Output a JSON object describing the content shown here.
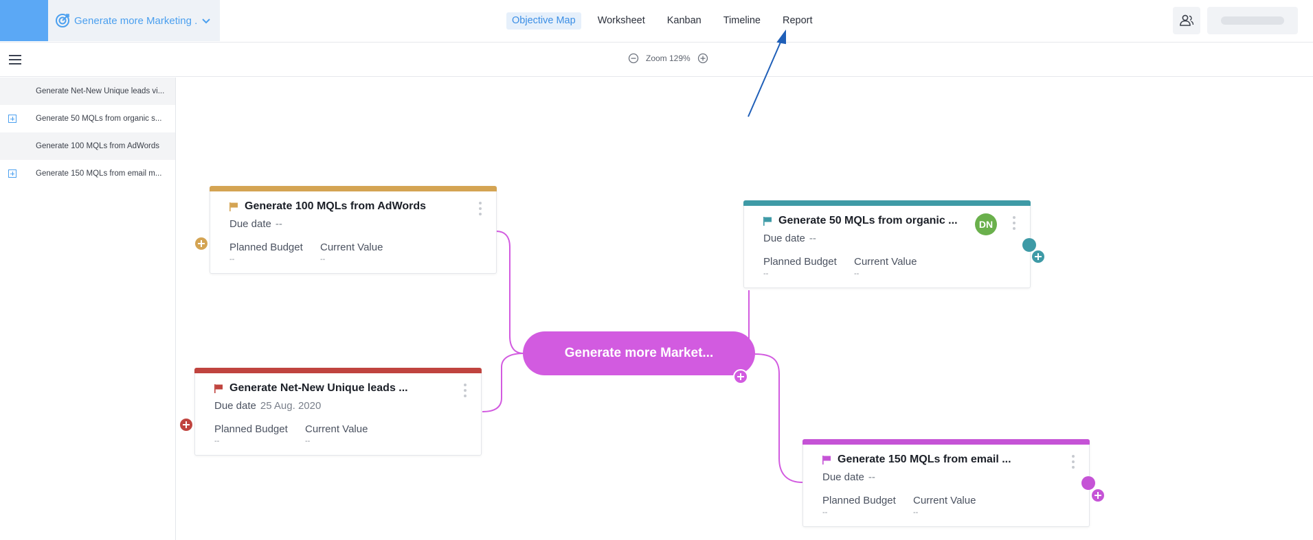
{
  "header": {
    "objective_selector": "Generate more Marketing ...",
    "tabs": [
      {
        "label": "Objective Map",
        "active": true
      },
      {
        "label": "Worksheet",
        "active": false
      },
      {
        "label": "Kanban",
        "active": false
      },
      {
        "label": "Timeline",
        "active": false
      },
      {
        "label": "Report",
        "active": false
      }
    ]
  },
  "toolbar": {
    "zoom_label": "Zoom 129%"
  },
  "sidebar": {
    "items": [
      {
        "label": "Generate Net-New Unique leads vi...",
        "expandable": false,
        "shaded": true
      },
      {
        "label": "Generate 50 MQLs from organic s...",
        "expandable": true,
        "shaded": false
      },
      {
        "label": "Generate 100 MQLs from AdWords",
        "expandable": false,
        "shaded": true
      },
      {
        "label": "Generate 150 MQLs from email m...",
        "expandable": true,
        "shaded": false
      }
    ]
  },
  "map": {
    "center_label": "Generate more Market...",
    "cards": [
      {
        "id": "adwords",
        "title": "Generate 100 MQLs from AdWords",
        "due_label": "Due date",
        "due_value": "--",
        "budget_label": "Planned Budget",
        "budget_value": "--",
        "current_label": "Current Value",
        "current_value": "--",
        "color": "#d4a453"
      },
      {
        "id": "organic",
        "title": "Generate 50 MQLs from organic    ...",
        "due_label": "Due date",
        "due_value": "--",
        "budget_label": "Planned Budget",
        "budget_value": "--",
        "current_label": "Current Value",
        "current_value": "--",
        "color": "#3e9aa6",
        "avatar": "DN",
        "avatar_color": "#6ab04c"
      },
      {
        "id": "netnew",
        "title": "Generate Net-New Unique leads    ...",
        "due_label": "Due date",
        "due_value": "25 Aug. 2020",
        "budget_label": "Planned Budget",
        "budget_value": "--",
        "current_label": "Current Value",
        "current_value": "--",
        "color": "#c0443f"
      },
      {
        "id": "email",
        "title": "Generate 150 MQLs from email    ...",
        "due_label": "Due date",
        "due_value": "--",
        "budget_label": "Planned Budget",
        "budget_value": "--",
        "current_label": "Current Value",
        "current_value": "--",
        "color": "#c553d6"
      }
    ]
  },
  "colors": {
    "accent": "#4a9fef",
    "center": "#d25be0",
    "arrow": "#1f5fb8"
  },
  "icons": [
    "target-icon",
    "chevron-down-icon",
    "people-icon",
    "menu-icon",
    "zoom-out-icon",
    "zoom-in-icon",
    "flag-icon",
    "more-vertical-icon",
    "plus-icon"
  ]
}
